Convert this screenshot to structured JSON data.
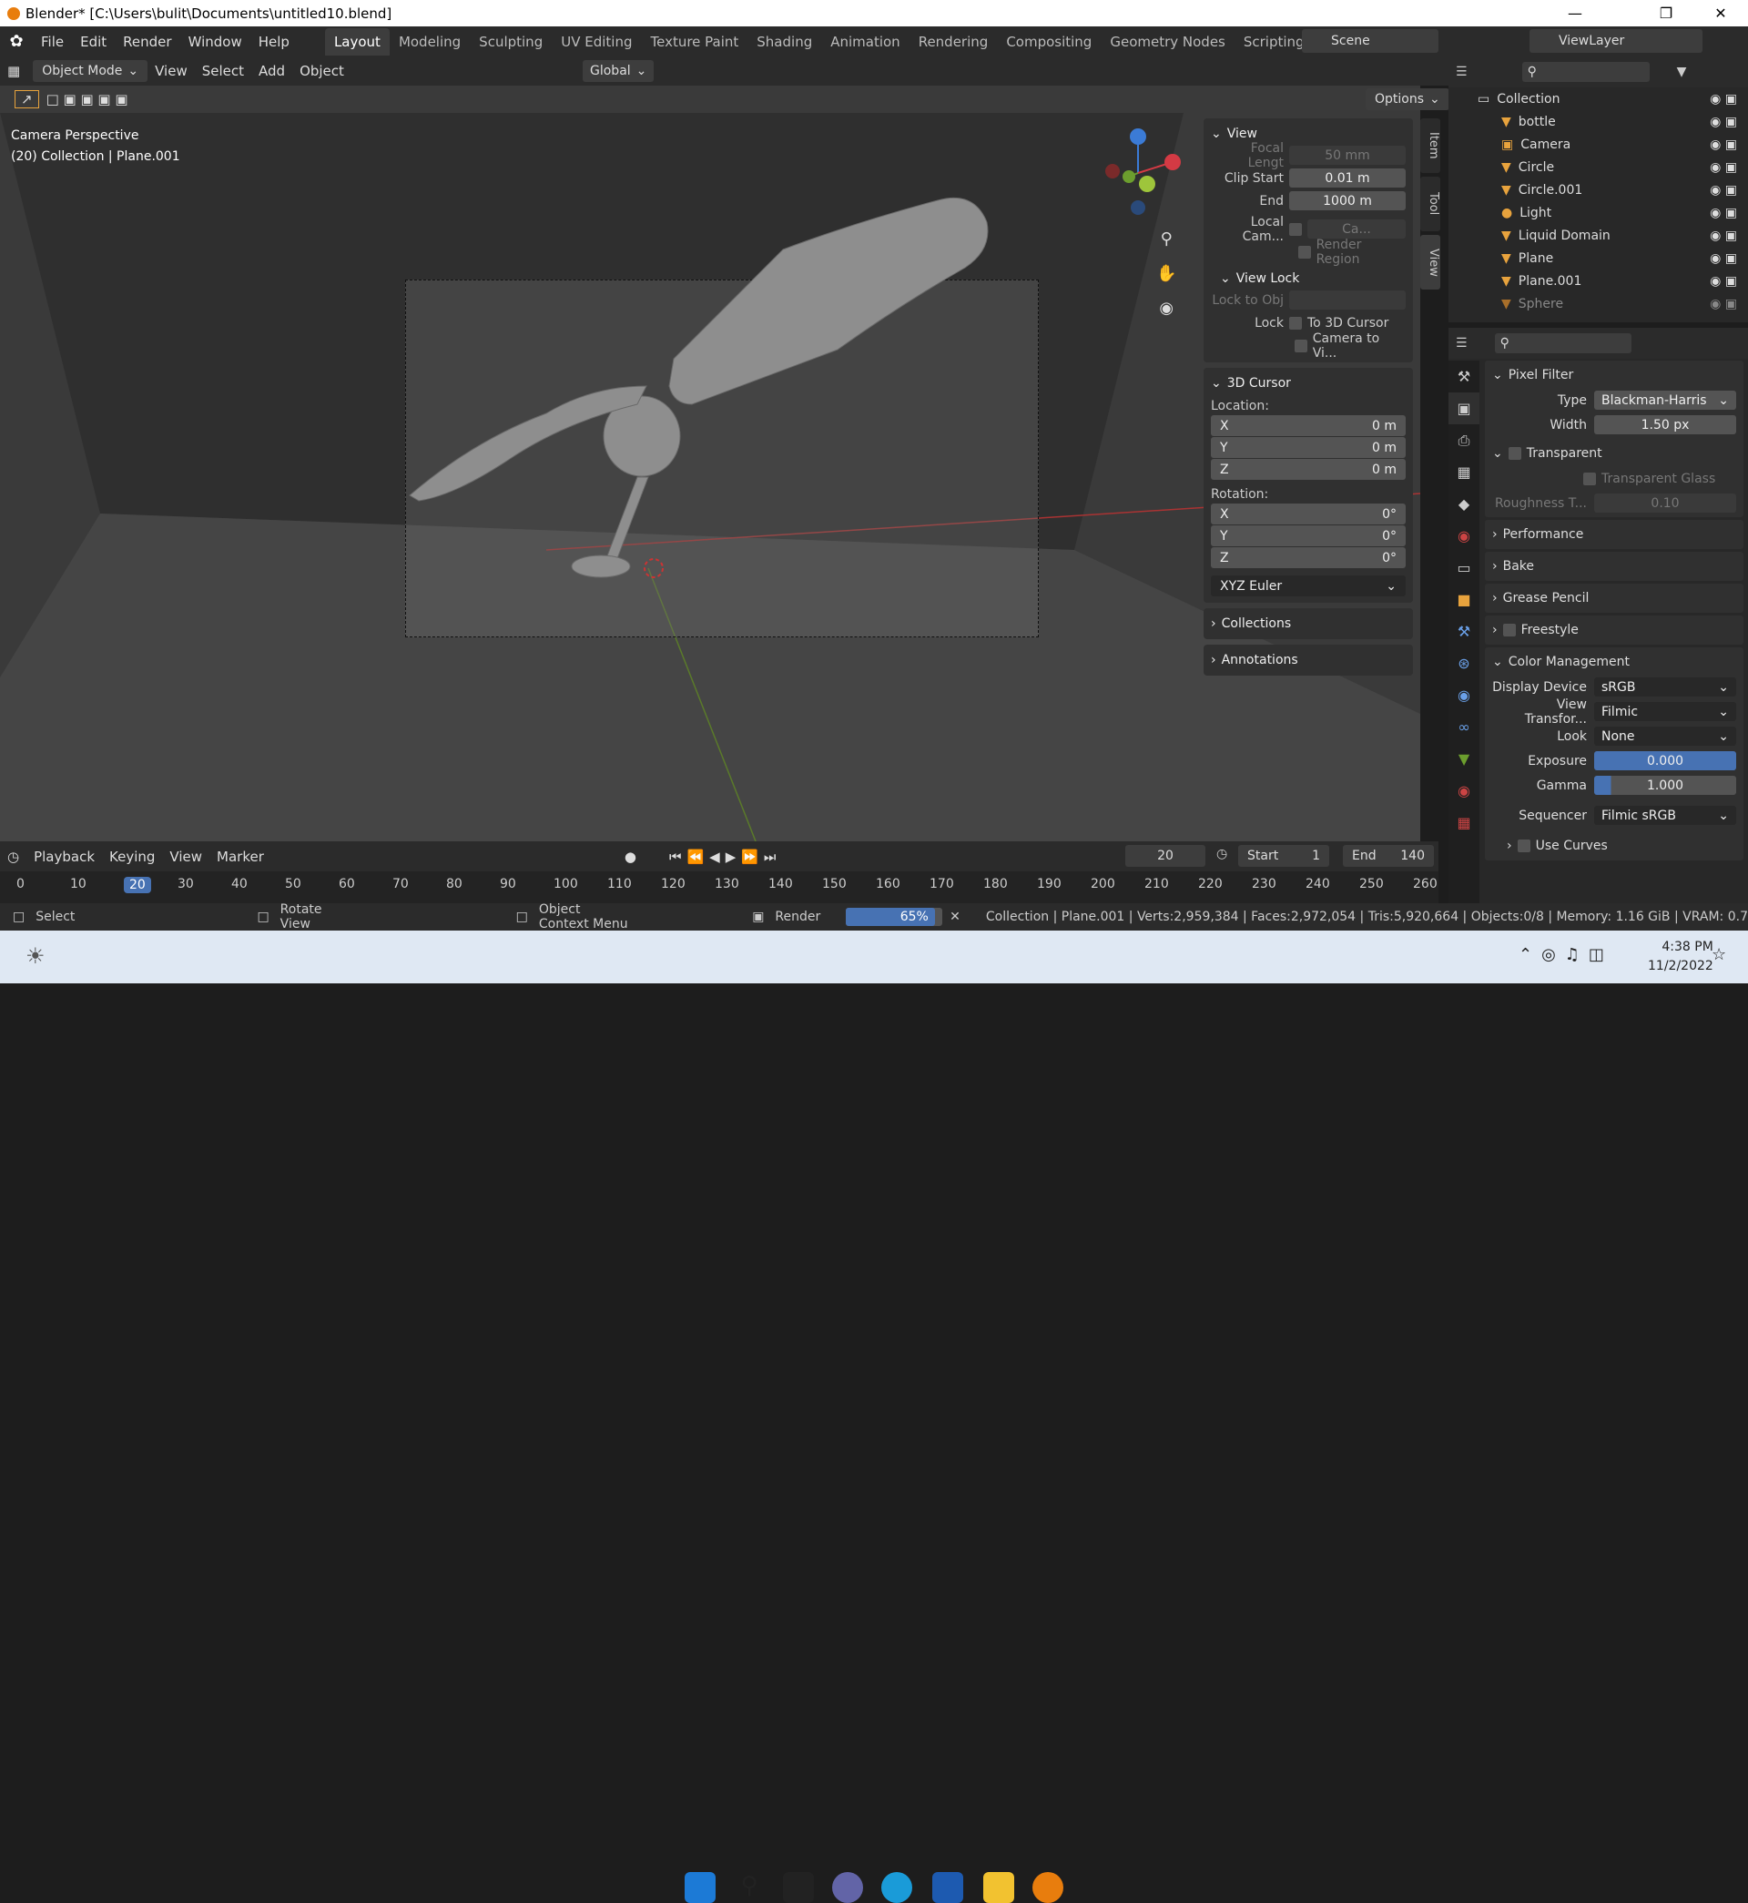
{
  "window": {
    "title": "Blender* [C:\\Users\\bulit\\Documents\\untitled10.blend]"
  },
  "menu": [
    "File",
    "Edit",
    "Render",
    "Window",
    "Help"
  ],
  "workspaces": [
    "Layout",
    "Modeling",
    "Sculpting",
    "UV Editing",
    "Texture Paint",
    "Shading",
    "Animation",
    "Rendering",
    "Compositing",
    "Geometry Nodes",
    "Scripting"
  ],
  "scene": "Scene",
  "view_layer": "ViewLayer",
  "viewport_header": {
    "mode": "Object Mode",
    "items": [
      "View",
      "Select",
      "Add",
      "Object"
    ],
    "transform": "Global",
    "options": "Options"
  },
  "viewport_overlay": {
    "line1": "Camera Perspective",
    "line2": "(20) Collection | Plane.001"
  },
  "npanel": {
    "view_title": "View",
    "focal_label": "Focal Lengt",
    "focal_value": "50 mm",
    "clip_start_label": "Clip Start",
    "clip_start_value": "0.01 m",
    "end_label": "End",
    "end_value": "1000 m",
    "local_cam_label": "Local Cam...",
    "local_cam_value": "Ca...",
    "render_region": "Render Region",
    "viewlock_title": "View Lock",
    "lock_obj_label": "Lock to Obj",
    "lock_label": "Lock",
    "to_cursor": "To 3D Cursor",
    "camera_to_view": "Camera to Vi...",
    "cursor_title": "3D Cursor",
    "location_label": "Location:",
    "rotation_label": "Rotation:",
    "loc": [
      {
        "axis": "X",
        "value": "0 m"
      },
      {
        "axis": "Y",
        "value": "0 m"
      },
      {
        "axis": "Z",
        "value": "0 m"
      }
    ],
    "rot": [
      {
        "axis": "X",
        "value": "0°"
      },
      {
        "axis": "Y",
        "value": "0°"
      },
      {
        "axis": "Z",
        "value": "0°"
      }
    ],
    "euler": "XYZ Euler",
    "collections": "Collections",
    "annotations": "Annotations"
  },
  "side_tabs": [
    "Item",
    "Tool",
    "View"
  ],
  "outliner": {
    "root": "Collection",
    "items": [
      "bottle",
      "Camera",
      "Circle",
      "Circle.001",
      "Light",
      "Liquid Domain",
      "Plane",
      "Plane.001",
      "Sphere"
    ]
  },
  "properties": {
    "pixel_filter": "Pixel Filter",
    "type_label": "Type",
    "type_value": "Blackman-Harris",
    "width_label": "Width",
    "width_value": "1.50 px",
    "transparent": "Transparent",
    "transparent_glass": "Transparent Glass",
    "roughness_label": "Roughness T...",
    "roughness_value": "0.10",
    "sections": [
      "Performance",
      "Bake",
      "Grease Pencil",
      "Freestyle"
    ],
    "color_mgmt": "Color Management",
    "display_label": "Display Device",
    "display_value": "sRGB",
    "view_label": "View Transfor...",
    "view_value": "Filmic",
    "look_label": "Look",
    "look_value": "None",
    "exposure_label": "Exposure",
    "exposure_value": "0.000",
    "gamma_label": "Gamma",
    "gamma_value": "1.000",
    "sequencer_label": "Sequencer",
    "sequencer_value": "Filmic sRGB",
    "use_curves": "Use Curves"
  },
  "timeline": {
    "menus": [
      "Playback",
      "Keying",
      "View",
      "Marker"
    ],
    "current": "20",
    "start_label": "Start",
    "start": "1",
    "end_label": "End",
    "end": "140",
    "ticks": [
      "0",
      "10",
      "20",
      "30",
      "40",
      "50",
      "60",
      "70",
      "80",
      "90",
      "100",
      "110",
      "120",
      "130",
      "140",
      "150",
      "160",
      "170",
      "180",
      "190",
      "200",
      "210",
      "220",
      "230",
      "240",
      "250",
      "260"
    ]
  },
  "status": {
    "select": "Select",
    "rotate": "Rotate View",
    "context": "Object Context Menu",
    "render": "Render",
    "progress": "65%",
    "progress_value": 65,
    "info": "Collection | Plane.001 | Verts:2,959,384 | Faces:2,972,054 | Tris:5,920,664 | Objects:0/8 | Memory: 1.16 GiB | VRAM: 0.7"
  },
  "taskbar": {
    "time": "4:38 PM",
    "date": "11/2/2022"
  }
}
